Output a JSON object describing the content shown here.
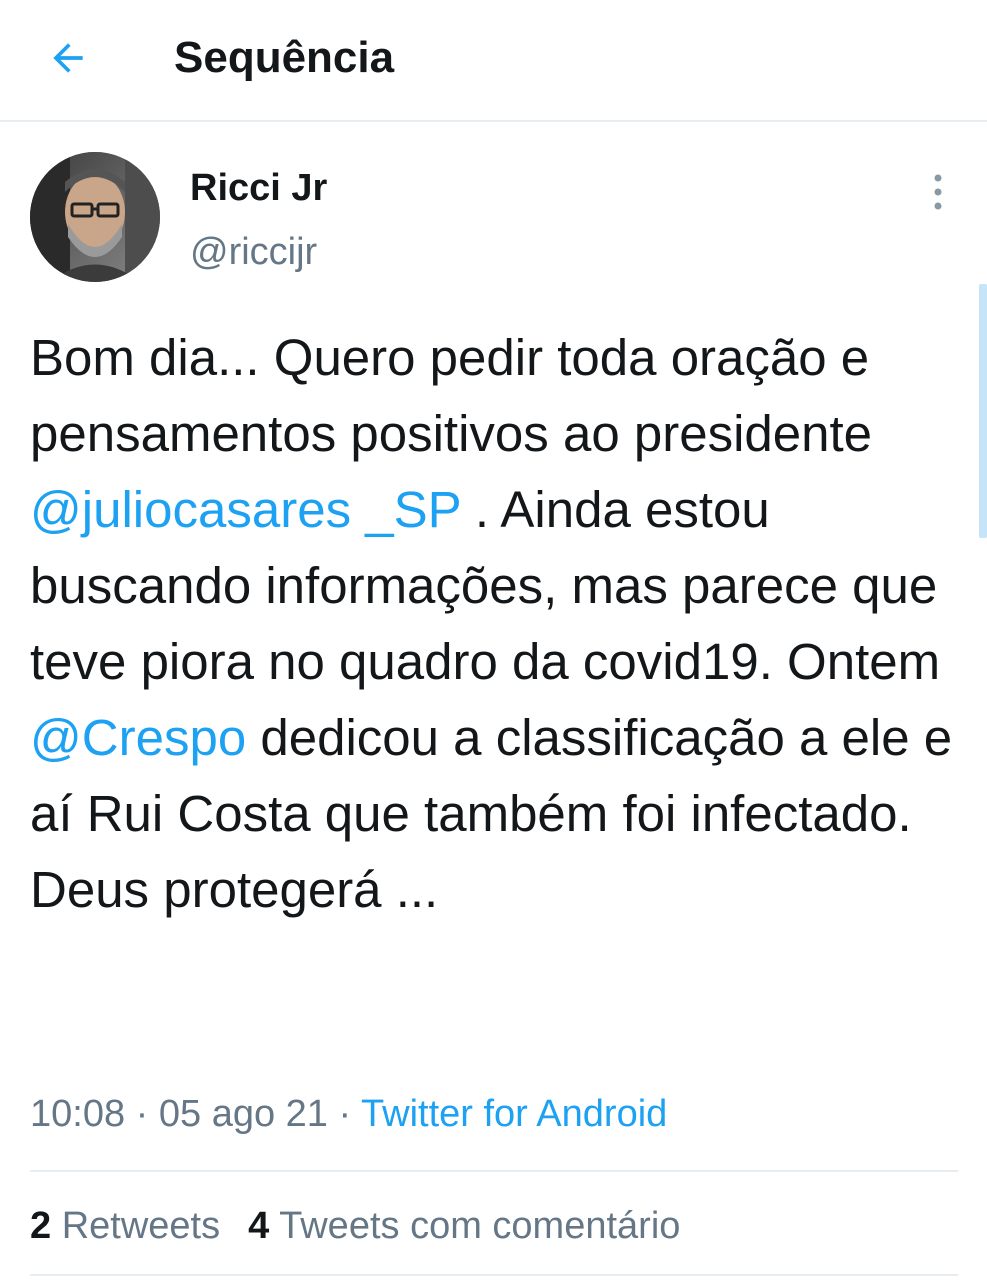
{
  "header": {
    "title": "Sequência",
    "back_icon": "arrow-left-icon"
  },
  "tweet": {
    "author": {
      "display_name": "Ricci Jr",
      "handle": "@riccijr",
      "avatar_icon": "user-avatar"
    },
    "more_icon": "vertical-ellipsis-icon",
    "segments": [
      {
        "text": "Bom dia... Quero pedir toda oração e pensamentos positivos ao presidente ",
        "type": "text"
      },
      {
        "text": "@juliocasares _SP",
        "type": "mention"
      },
      {
        "text": " . Ainda estou buscando informações, mas parece que teve piora no quadro da covid19. Ontem ",
        "type": "text"
      },
      {
        "text": "@Crespo",
        "type": "mention"
      },
      {
        "text": " dedicou a classificação a ele e aí Rui Costa que também foi infectado. Deus protegerá ...",
        "type": "text"
      }
    ],
    "time": "10:08",
    "date": "05 ago 21",
    "separator": "·",
    "source": "Twitter for Android"
  },
  "stats": {
    "retweets_count": "2",
    "retweets_label": "Retweets",
    "quotes_count": "4",
    "quotes_label": "Tweets com comentário"
  },
  "colors": {
    "accent": "#1da1f2",
    "text": "#14171a",
    "secondary": "#657786",
    "divider": "#e6ecf0"
  }
}
